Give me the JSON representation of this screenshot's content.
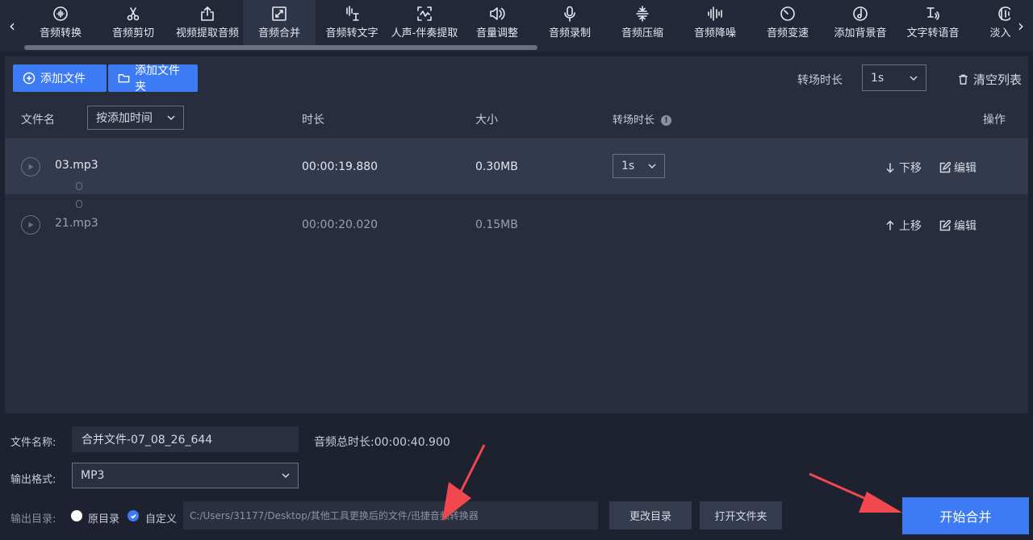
{
  "toolbar": {
    "tabs": [
      {
        "label": "音频转换",
        "icon": "audio-convert-icon"
      },
      {
        "label": "音频剪切",
        "icon": "scissors-icon"
      },
      {
        "label": "视频提取音频",
        "icon": "upload-icon"
      },
      {
        "label": "音频合并",
        "icon": "merge-icon"
      },
      {
        "label": "音频转文字",
        "icon": "speech-to-text-icon"
      },
      {
        "label": "人声-伴奏提取",
        "icon": "waveform-box-icon"
      },
      {
        "label": "音量调整",
        "icon": "volume-icon"
      },
      {
        "label": "音频录制",
        "icon": "microphone-icon"
      },
      {
        "label": "音频压缩",
        "icon": "compress-icon"
      },
      {
        "label": "音频降噪",
        "icon": "noise-reduction-icon"
      },
      {
        "label": "音频变速",
        "icon": "speed-icon"
      },
      {
        "label": "添加背景音",
        "icon": "music-disc-icon"
      },
      {
        "label": "文字转语音",
        "icon": "text-to-speech-icon"
      },
      {
        "label": "淡入淡",
        "icon": "fade-icon"
      }
    ],
    "active_index": 3
  },
  "actions": {
    "add_file": "添加文件",
    "add_folder": "添加文件夹",
    "transition_label": "转场时长",
    "transition_value": "1s",
    "clear_list": "清空列表"
  },
  "table": {
    "headers": {
      "filename": "文件名",
      "sort": "按添加时间",
      "duration": "时长",
      "size": "大小",
      "transition": "转场时长",
      "operation": "操作",
      "info": "!"
    },
    "rows": [
      {
        "name": "03.mp3",
        "duration": "00:00:19.880",
        "size": "0.30MB",
        "transition": "1s",
        "move": "下移",
        "edit": "编辑"
      },
      {
        "name": "21.mp3",
        "duration": "00:00:20.020",
        "size": "0.15MB",
        "transition": "",
        "move": "上移",
        "edit": "编辑"
      }
    ]
  },
  "bottom": {
    "filename_label": "文件名称:",
    "filename_value": "合并文件-07_08_26_644",
    "total_label": "音频总时长:",
    "total_value": "00:00:40.900",
    "format_label": "输出格式:",
    "format_value": "MP3",
    "output_label": "输出目录:",
    "option_original": "原目录",
    "option_custom": "自定义",
    "output_path": "C:/Users/31177/Desktop/其他工具更换后的文件/迅捷音频转换器",
    "change_dir": "更改目录",
    "open_folder": "打开文件夹",
    "start": "开始合并"
  },
  "colors": {
    "accent": "#3d7bf5",
    "annotation_arrow": "#f0484e"
  }
}
